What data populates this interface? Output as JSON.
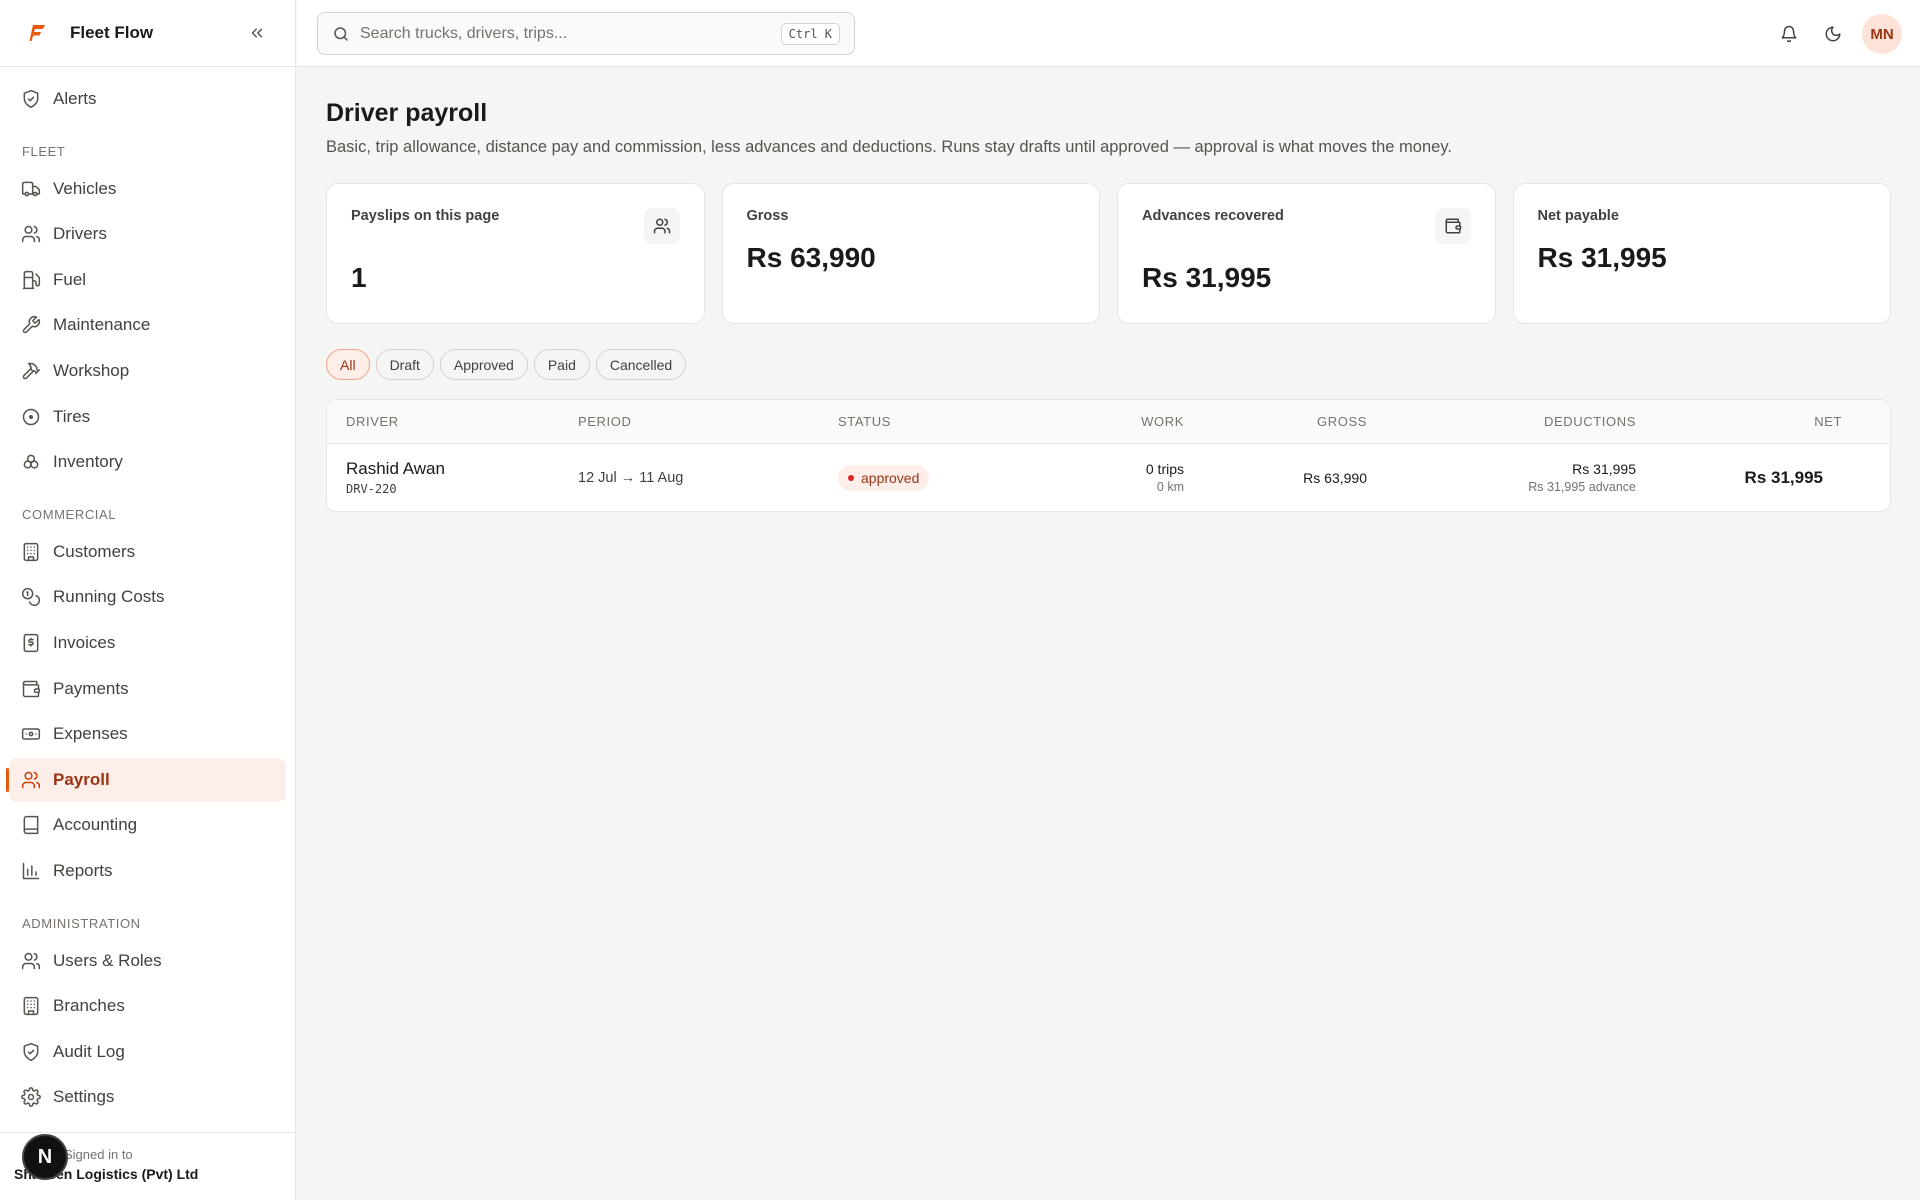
{
  "app": {
    "name": "Fleet Flow"
  },
  "sidebar": {
    "top_items": [
      {
        "label": "Alerts",
        "icon": "shield-icon"
      }
    ],
    "sections": [
      {
        "title": "FLEET",
        "items": [
          {
            "label": "Vehicles",
            "icon": "truck-icon"
          },
          {
            "label": "Drivers",
            "icon": "users-icon"
          },
          {
            "label": "Fuel",
            "icon": "fuel-icon"
          },
          {
            "label": "Maintenance",
            "icon": "wrench-icon"
          },
          {
            "label": "Workshop",
            "icon": "hammer-icon"
          },
          {
            "label": "Tires",
            "icon": "tire-icon"
          },
          {
            "label": "Inventory",
            "icon": "boxes-icon"
          }
        ]
      },
      {
        "title": "COMMERCIAL",
        "items": [
          {
            "label": "Customers",
            "icon": "building-icon"
          },
          {
            "label": "Running Costs",
            "icon": "coins-icon"
          },
          {
            "label": "Invoices",
            "icon": "invoice-icon"
          },
          {
            "label": "Payments",
            "icon": "wallet-icon"
          },
          {
            "label": "Expenses",
            "icon": "banknote-icon"
          },
          {
            "label": "Payroll",
            "icon": "users-icon",
            "active": true
          },
          {
            "label": "Accounting",
            "icon": "book-icon"
          },
          {
            "label": "Reports",
            "icon": "bar-chart-icon"
          }
        ]
      },
      {
        "title": "ADMINISTRATION",
        "items": [
          {
            "label": "Users & Roles",
            "icon": "users-icon"
          },
          {
            "label": "Branches",
            "icon": "building-icon"
          },
          {
            "label": "Audit Log",
            "icon": "shield-icon"
          },
          {
            "label": "Settings",
            "icon": "gear-icon"
          }
        ]
      }
    ],
    "footer": {
      "label": "Signed in to",
      "org": "Shaheen Logistics (Pvt) Ltd",
      "badge": "N"
    }
  },
  "topbar": {
    "search_placeholder": "Search trucks, drivers, trips...",
    "shortcut": "Ctrl K",
    "avatar_initials": "MN"
  },
  "page": {
    "title": "Driver payroll",
    "description": "Basic, trip allowance, distance pay and commission, less advances and deductions. Runs stay drafts until approved — approval is what moves the money."
  },
  "cards": [
    {
      "label": "Payslips on this page",
      "value": "1",
      "icon": "users-icon"
    },
    {
      "label": "Gross",
      "value": "Rs 63,990",
      "icon": ""
    },
    {
      "label": "Advances recovered",
      "value": "Rs 31,995",
      "icon": "wallet-icon"
    },
    {
      "label": "Net payable",
      "value": "Rs 31,995",
      "icon": ""
    }
  ],
  "filters": [
    {
      "label": "All",
      "active": true
    },
    {
      "label": "Draft"
    },
    {
      "label": "Approved"
    },
    {
      "label": "Paid"
    },
    {
      "label": "Cancelled"
    }
  ],
  "table": {
    "headers": {
      "driver": "DRIVER",
      "period": "PERIOD",
      "status": "STATUS",
      "work": "WORK",
      "gross": "GROSS",
      "deductions": "DEDUCTIONS",
      "net": "NET"
    },
    "rows": [
      {
        "driver_name": "Rashid Awan",
        "driver_code": "DRV-220",
        "period": "12 Jul → 11 Aug",
        "status": "approved",
        "work_trips": "0 trips",
        "work_km": "0 km",
        "gross": "Rs 63,990",
        "deductions": "Rs 31,995",
        "deductions_note": "Rs 31,995 advance",
        "net": "Rs 31,995"
      }
    ]
  }
}
